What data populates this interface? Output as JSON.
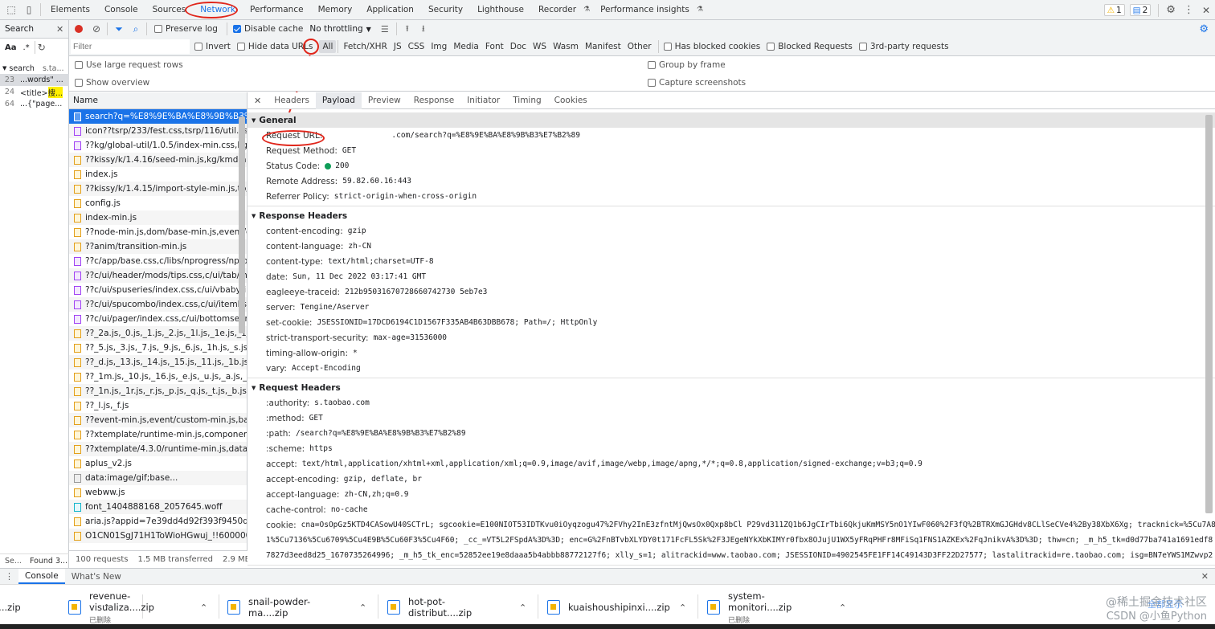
{
  "tabs": [
    "Elements",
    "Console",
    "Sources",
    "Network",
    "Performance",
    "Memory",
    "Application",
    "Security",
    "Lighthouse",
    "Recorder",
    "Performance insights"
  ],
  "badges": {
    "warn": "1",
    "msg": "2"
  },
  "search_panel": {
    "label": "Search",
    "case_label": "Aa",
    "regex_label": ".*",
    "results": [
      {
        "line": "23",
        "text": "...words\" ..."
      },
      {
        "line": "24",
        "text": "<title>搜..."
      },
      {
        "line": "64",
        "text": "...{\"page..."
      }
    ],
    "result_head": "search",
    "result_head2": "s.ta...",
    "footer_left": "Se...",
    "footer_right": "Found 3..."
  },
  "toolbar": {
    "preserve_log": "Preserve log",
    "disable_cache": "Disable cache",
    "throttling": "No throttling"
  },
  "filter": {
    "placeholder": "Filter",
    "invert": "Invert",
    "hide_data_urls": "Hide data URLs",
    "types": [
      "All",
      "Fetch/XHR",
      "JS",
      "CSS",
      "Img",
      "Media",
      "Font",
      "Doc",
      "WS",
      "Wasm",
      "Manifest",
      "Other"
    ],
    "has_blocked_cookies": "Has blocked cookies",
    "blocked_requests": "Blocked Requests",
    "third_party": "3rd-party requests"
  },
  "options": {
    "large_rows": "Use large request rows",
    "show_overview": "Show overview",
    "group_by_frame": "Group by frame",
    "capture_screenshots": "Capture screenshots"
  },
  "network": {
    "name_header": "Name",
    "requests": [
      {
        "name": "search?q=%E8%9E%BA%E8%9B%B3%E7...",
        "type": "doc"
      },
      {
        "name": "icon??tsrp/233/fest.css,tsrp/116/util.css",
        "type": "css"
      },
      {
        "name": "??kg/global-util/1.0.5/index-min.css,kg/tb...",
        "type": "css"
      },
      {
        "name": "??kissy/k/1.4.16/seed-min.js,kg/kmd-ada...",
        "type": "js"
      },
      {
        "name": "index.js",
        "type": "js"
      },
      {
        "name": "??kissy/k/1.4.15/import-style-min.js,tb/tra...",
        "type": "js"
      },
      {
        "name": "config.js",
        "type": "js"
      },
      {
        "name": "index-min.js",
        "type": "js"
      },
      {
        "name": "??node-min.js,dom/base-min.js,event/do...",
        "type": "js"
      },
      {
        "name": "??anim/transition-min.js",
        "type": "js"
      },
      {
        "name": "??c/app/base.css,c/libs/nprogress/nprogr...",
        "type": "css"
      },
      {
        "name": "??c/ui/header/mods/tips.css,c/ui/tab/inde...",
        "type": "css"
      },
      {
        "name": "??c/ui/spuseries/index.css,c/ui/vbaby/ind...",
        "type": "css"
      },
      {
        "name": "??c/ui/spucombo/index.css,c/ui/itemlist/i...",
        "type": "css"
      },
      {
        "name": "??c/ui/pager/index.css,c/ui/bottomsearch...",
        "type": "css"
      },
      {
        "name": "??_2a.js,_0.js,_1.js,_2.js,_1l.js,_1e.js,_1j.js,_1g...",
        "type": "js"
      },
      {
        "name": "??_5.js,_3.js,_7.js,_9.js,_6.js,_1h.js,_s.js,_4.js,...",
        "type": "js"
      },
      {
        "name": "??_d.js,_13.js,_14.js,_15.js,_11.js,_1b.js,_v.js,...",
        "type": "js"
      },
      {
        "name": "??_1m.js,_10.js,_16.js,_e.js,_u.js,_a.js,_17.js,...",
        "type": "js"
      },
      {
        "name": "??_1n.js,_1r.js,_r.js,_p.js,_q.js,_t.js,_b.js,_i.js,...",
        "type": "js"
      },
      {
        "name": "??_l.js,_f.js",
        "type": "js"
      },
      {
        "name": "??event-min.js,event/custom-min.js,base-...",
        "type": "js"
      },
      {
        "name": "??xtemplate/runtime-min.js,component/e...",
        "type": "js"
      },
      {
        "name": "??xtemplate/4.3.0/runtime-min.js,datalazy...",
        "type": "js"
      },
      {
        "name": "aplus_v2.js",
        "type": "js"
      },
      {
        "name": "data:image/gif;base...",
        "type": "img"
      },
      {
        "name": "webww.js",
        "type": "js"
      },
      {
        "name": "font_1404888168_2057645.woff",
        "type": "font"
      },
      {
        "name": "aria.js?appid=7e39dd4d92f393f9450d8fc...",
        "type": "js"
      },
      {
        "name": "O1CN01SgJ71H1ToWioHGwuj_!!6000000...",
        "type": "js"
      }
    ],
    "status": {
      "requests": "100 requests",
      "transferred": "1.5 MB transferred",
      "resources": "2.9 MB r..."
    }
  },
  "detail": {
    "tabs": [
      "Headers",
      "Payload",
      "Preview",
      "Response",
      "Initiator",
      "Timing",
      "Cookies"
    ],
    "general_title": "General",
    "general": [
      {
        "k": "Request URL:",
        "v": "              .com/search?q=%E8%9E%BA%E8%9B%B3%E7%B2%89"
      },
      {
        "k": "Request Method:",
        "v": "GET"
      },
      {
        "k": "Status Code:",
        "v": "200"
      },
      {
        "k": "Remote Address:",
        "v": "59.82.60.16:443"
      },
      {
        "k": "Referrer Policy:",
        "v": "strict-origin-when-cross-origin"
      }
    ],
    "response_title": "Response Headers",
    "response": [
      {
        "k": "content-encoding:",
        "v": "gzip"
      },
      {
        "k": "content-language:",
        "v": "zh-CN"
      },
      {
        "k": "content-type:",
        "v": "text/html;charset=UTF-8"
      },
      {
        "k": "date:",
        "v": "Sun, 11 Dec 2022 03:17:41 GMT"
      },
      {
        "k": "eagleeye-traceid:",
        "v": "212b95031670728660742730 5eb7e3"
      },
      {
        "k": "server:",
        "v": "Tengine/Aserver"
      },
      {
        "k": "set-cookie:",
        "v": "JSESSIONID=17DCD6194C1D1567F335AB4B63DBB678; Path=/; HttpOnly"
      },
      {
        "k": "strict-transport-security:",
        "v": "max-age=31536000"
      },
      {
        "k": "timing-allow-origin:",
        "v": "*"
      },
      {
        "k": "vary:",
        "v": "Accept-Encoding"
      }
    ],
    "request_title": "Request Headers",
    "request": [
      {
        "k": ":authority:",
        "v": "s.taobao.com"
      },
      {
        "k": ":method:",
        "v": "GET"
      },
      {
        "k": ":path:",
        "v": "/search?q=%E8%9E%BA%E8%9B%B3%E7%B2%89"
      },
      {
        "k": ":scheme:",
        "v": "https"
      },
      {
        "k": "accept:",
        "v": "text/html,application/xhtml+xml,application/xml;q=0.9,image/avif,image/webp,image/apng,*/*;q=0.8,application/signed-exchange;v=b3;q=0.9"
      },
      {
        "k": "accept-encoding:",
        "v": "gzip, deflate, br"
      },
      {
        "k": "accept-language:",
        "v": "zh-CN,zh;q=0.9"
      },
      {
        "k": "cache-control:",
        "v": "no-cache"
      },
      {
        "k": "cookie:",
        "v": "cna=OsOpGz5KTD4CASowU40SCTrL; sgcookie=E100NIOT53IDTKvu0iOyqzogu47%2FVhy2InE3zfntMjQwsOx0Qxp8bCl P29vd311ZQ1b6JgCIrTbi6QkjuKmMSY5nO1YIwF060%2F3fQ%2BTRXmGJGHdv8CLlSeCVe4%2By38XbX6Xg; tracknick=%5Cu7A8"
      },
      {
        "k": "",
        "v": "1%5Cu7136%5Cu6709%5Cu4E9B%5Cu60F3%5Cu4F60; _cc_=VT5L2FSpdA%3D%3D; enc=G%2FnBTvbXLYDY0t171FcFL5Sk%2F3JEgeNYkXbKIMYr0fbx8OJujU1WX5yFRqPHFr8MFiSq1FNS1AZKEx%2FqJnikvA%3D%3D; thw=cn; _m_h5_tk=d0d77ba741a1691edf8"
      },
      {
        "k": "",
        "v": "7827d3eed8d25_1670735264996; _m_h5_tk_enc=52852ee19e8daaa5b4abbb88772127f6; xlly_s=1; alitrackid=www.taobao.com; JSESSIONID=4902545FE1FF14C49143D3FF22D27577; lastalitrackid=re.taobao.com; isg=BN7eYWS1MZwvp2"
      }
    ]
  },
  "drawer": {
    "console": "Console",
    "whats_new": "What's New"
  },
  "downloads": [
    {
      "name": "t....zip",
      "status": ""
    },
    {
      "name": "revenue-visualiza....zip",
      "status": "已删除"
    },
    {
      "name": "snail-powder-ma....zip",
      "status": ""
    },
    {
      "name": "hot-pot-distribut....zip",
      "status": ""
    },
    {
      "name": "kuaishoushipinxi....zip",
      "status": ""
    },
    {
      "name": "system-monitori....zip",
      "status": "已删除"
    }
  ],
  "watermark": {
    "line1": "@稀土掘金技术社区",
    "line2": "CSDN @小鱼Python",
    "show_all": "全部显示"
  },
  "colors": {
    "accent": "#1a73e8",
    "annotation": "#e0261b",
    "status_ok": "#0f9d58"
  }
}
